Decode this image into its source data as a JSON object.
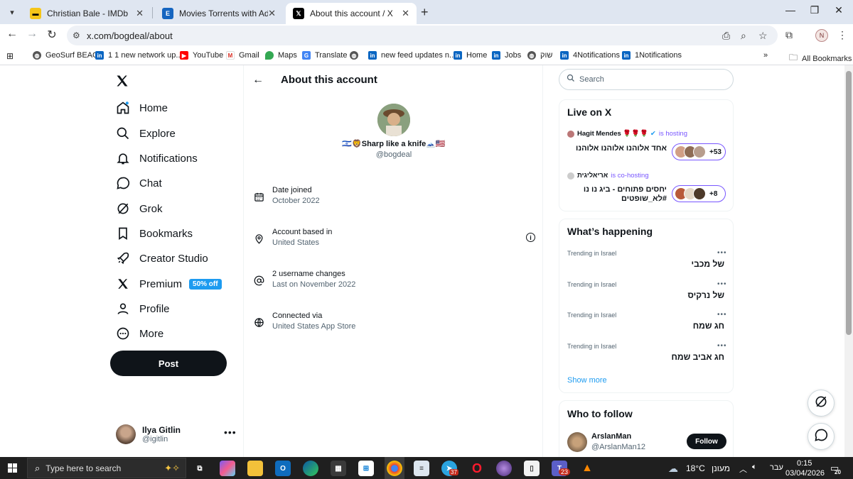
{
  "browser": {
    "tabs": [
      {
        "title": "Christian Bale - IMDb",
        "icon": "imdb-icon",
        "color": "#f5c518"
      },
      {
        "title": "Movies Torrents with Added: le",
        "icon": "e-icon",
        "color": "#1565c0"
      },
      {
        "title": "About this account / X",
        "icon": "x-icon",
        "color": "#000000"
      }
    ],
    "url": "x.com/bogdeal/about",
    "profile_initial": "N",
    "bookmarks": [
      {
        "label": "GeoSurf BEAC",
        "icon": "globe-icon"
      },
      {
        "label": "1 1 new network up...",
        "icon": "linkedin-icon"
      },
      {
        "label": "YouTube",
        "icon": "youtube-icon"
      },
      {
        "label": "Gmail",
        "icon": "gmail-icon"
      },
      {
        "label": "Maps",
        "icon": "maps-icon"
      },
      {
        "label": "Translate",
        "icon": "translate-icon"
      },
      {
        "label": "",
        "icon": "globe-icon"
      },
      {
        "label": "new feed updates n...",
        "icon": "linkedin-icon"
      },
      {
        "label": "Home",
        "icon": "linkedin-icon"
      },
      {
        "label": "Jobs",
        "icon": "linkedin-icon"
      },
      {
        "label": "שוק",
        "icon": "globe-icon"
      },
      {
        "label": "4Notifications",
        "icon": "linkedin-icon"
      },
      {
        "label": "1Notifications",
        "icon": "linkedin-icon"
      }
    ],
    "all_bookmarks": "All Bookmarks"
  },
  "sidebar": {
    "items": [
      {
        "label": "Home",
        "icon": "home-icon"
      },
      {
        "label": "Explore",
        "icon": "search-icon"
      },
      {
        "label": "Notifications",
        "icon": "bell-icon"
      },
      {
        "label": "Chat",
        "icon": "chat-icon"
      },
      {
        "label": "Grok",
        "icon": "grok-icon"
      },
      {
        "label": "Bookmarks",
        "icon": "bookmark-icon"
      },
      {
        "label": "Creator Studio",
        "icon": "rocket-icon"
      },
      {
        "label": "Premium",
        "icon": "x-icon"
      },
      {
        "label": "Profile",
        "icon": "person-icon"
      },
      {
        "label": "More",
        "icon": "more-circle-icon"
      }
    ],
    "premium_badge": "50% off",
    "post_label": "Post",
    "user": {
      "name": "Ilya Gitlin",
      "handle": "@igitlin"
    }
  },
  "main": {
    "title": "About this account",
    "display_name": "🇮🇱🦁Sharp like a knife🗻🇺🇸",
    "handle": "@bogdeal",
    "info": [
      {
        "label": "Date joined",
        "value": "October 2022",
        "icon": "calendar-icon"
      },
      {
        "label": "Account based in",
        "value": "United States",
        "icon": "location-icon"
      },
      {
        "label": "2 username changes",
        "value": "Last on November 2022",
        "icon": "at-icon"
      },
      {
        "label": "Connected via",
        "value": "United States App Store",
        "icon": "globe-icon"
      }
    ]
  },
  "right": {
    "search_placeholder": "Search",
    "live": {
      "title": "Live on X",
      "spaces": [
        {
          "host": "Hagit Mendes 🌹🌹🌹",
          "status": "is hosting",
          "title": "אחד אלוהנו אלוהנו אלוהנו",
          "count": "+53"
        },
        {
          "host": "אריאליגית",
          "status": "is co-hosting",
          "title": "יחסים פתוחים - ביג נו נו #לא_שופטים",
          "count": "+8"
        }
      ]
    },
    "happening": {
      "title": "What’s happening",
      "trends": [
        {
          "context": "Trending in Israel",
          "name": "של מכבי"
        },
        {
          "context": "Trending in Israel",
          "name": "של נרקיס"
        },
        {
          "context": "Trending in Israel",
          "name": "חג שמח"
        },
        {
          "context": "Trending in Israel",
          "name": "חג אביב שמח"
        }
      ],
      "show_more": "Show more"
    },
    "who_to_follow": {
      "title": "Who to follow",
      "user": {
        "name": "ArslanMan",
        "handle": "@ArslanMan12"
      },
      "follow_label": "Follow"
    }
  },
  "taskbar": {
    "search_placeholder": "Type here to search",
    "weather": "18°C",
    "weather_label": "מעונן",
    "lang": "עבר",
    "time": "0:15",
    "date": "03/04/2026",
    "notif_count": "20",
    "badge_mail": "23",
    "badge_telegram": "37"
  }
}
